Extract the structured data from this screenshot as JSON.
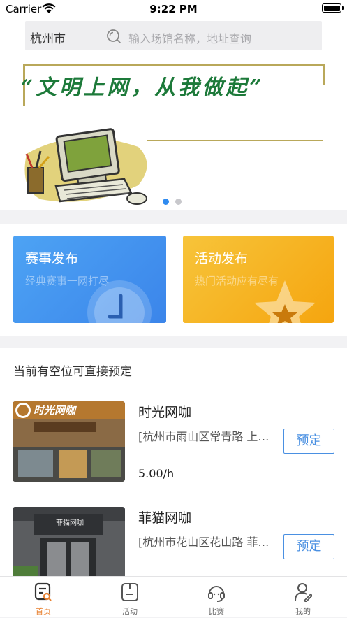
{
  "status_bar": {
    "carrier": "Carrier",
    "time": "9:22 PM"
  },
  "header": {
    "city": "杭州市",
    "search_placeholder": "输入场馆名称，地址查询"
  },
  "banner": {
    "slogan": "“文明上网，从我做起”",
    "page_count": 2,
    "active_index": 0
  },
  "quick_cards": [
    {
      "title": "赛事发布",
      "subtitle": "经典赛事一网打尽",
      "color": "#3b85ea"
    },
    {
      "title": "活动发布",
      "subtitle": "热门活动应有尽有",
      "color": "#f5a50f"
    }
  ],
  "section": {
    "title": "当前有空位可直接预定"
  },
  "venues": [
    {
      "name": "时光网咖",
      "address": "[杭州市雨山区常青路 上网就是时光",
      "price": "5.00/h",
      "book_label": "预定",
      "thumb_sign": "时光网咖"
    },
    {
      "name": "菲猫网咖",
      "address": "[杭州市花山区花山路 菲猫网咖",
      "price": "",
      "book_label": "预定",
      "thumb_sign": "菲猫网咖"
    }
  ],
  "tabs": [
    {
      "label": "首页",
      "icon": "home-icon",
      "active": true
    },
    {
      "label": "活动",
      "icon": "activity-icon",
      "active": false
    },
    {
      "label": "比赛",
      "icon": "headset-icon",
      "active": false
    },
    {
      "label": "我的",
      "icon": "profile-icon",
      "active": false
    }
  ],
  "colors": {
    "accent": "#e8802f",
    "link_blue": "#4a90e2",
    "dot_active": "#2f8bf0",
    "dot_inactive": "#c8c8cc"
  }
}
